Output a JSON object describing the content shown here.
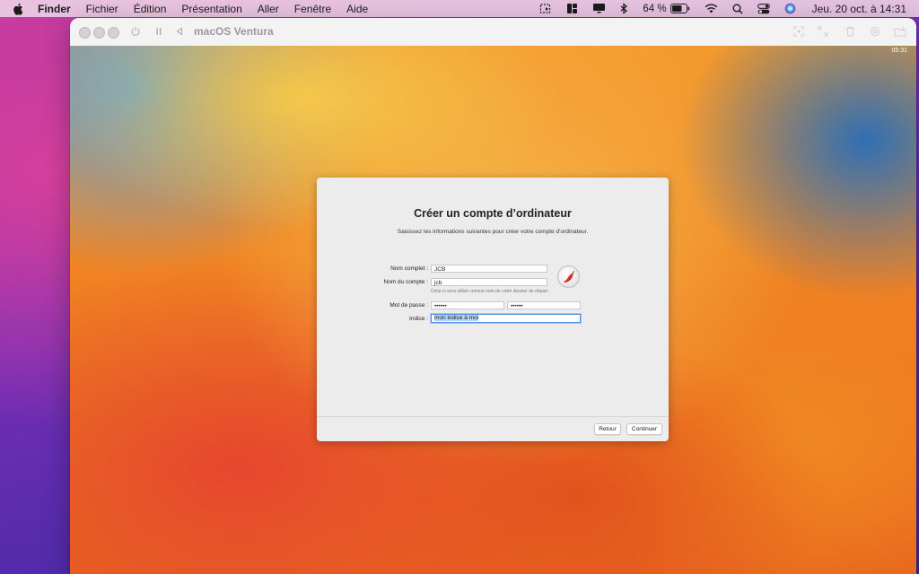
{
  "menubar": {
    "app_name": "Finder",
    "menus": [
      "Fichier",
      "Édition",
      "Présentation",
      "Aller",
      "Fenêtre",
      "Aide"
    ],
    "battery_percent": "64 %",
    "clock": "Jeu. 20 oct. à  14:31"
  },
  "window": {
    "title": "macOS Ventura",
    "vm_clock": "05:31"
  },
  "dialog": {
    "title": "Créer un compte d’ordinateur",
    "subtitle": "Saisissez les informations suivantes pour créer votre compte d’ordinateur.",
    "full_name_label": "Nom complet :",
    "full_name_value": "JCB",
    "account_name_label": "Nom du compte :",
    "account_name_value": "jcb",
    "account_hint": "Celui-ci sera utilisé comme nom de votre dossier de départ.",
    "password_label": "Mot de passe :",
    "password_value": "••••••",
    "password_verify_value": "••••••",
    "hint_label": "Indice :",
    "hint_value": "mon indice à moi",
    "back_button": "Retour",
    "continue_button": "Continuer"
  },
  "colors": {
    "focus_ring": "#4a8fe3",
    "selection": "#b3d3f6"
  },
  "icons": {
    "avatar": "chili-pepper-icon"
  }
}
